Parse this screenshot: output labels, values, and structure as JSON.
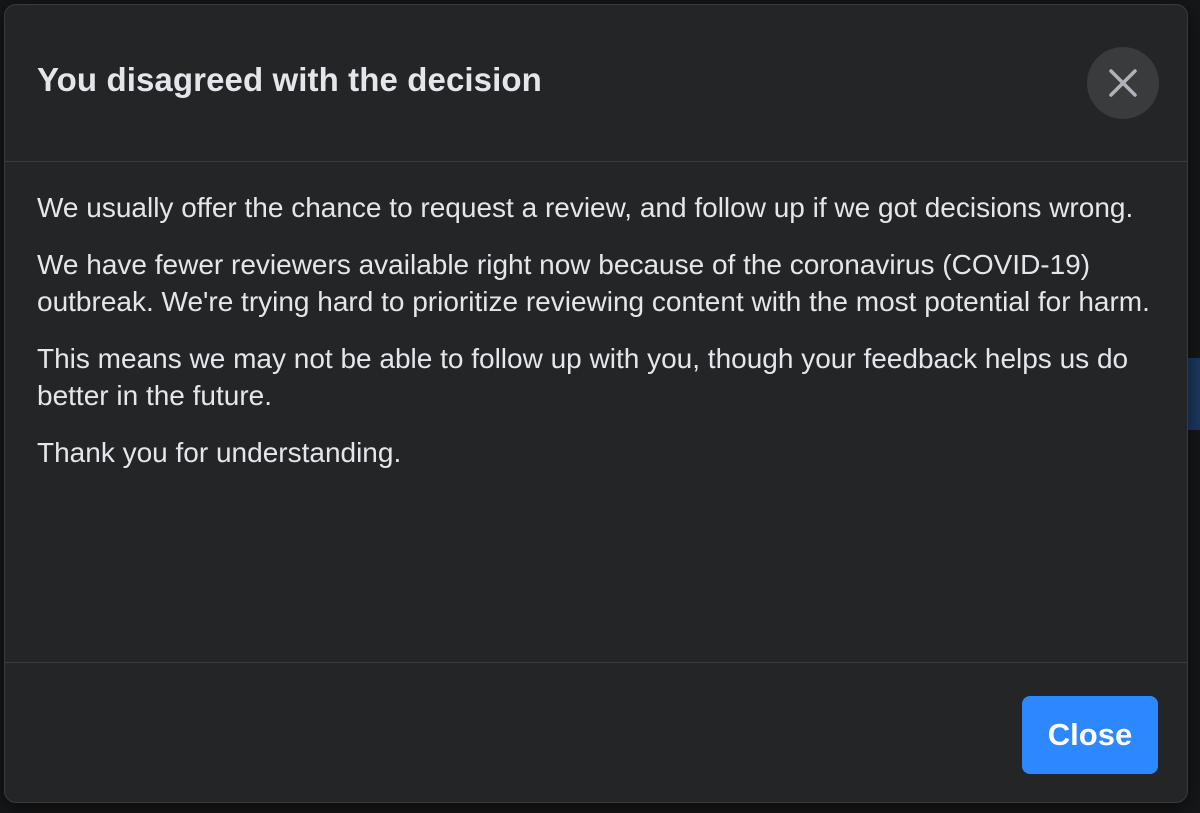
{
  "dialog": {
    "title": "You disagreed with the decision",
    "close_icon": "close-icon",
    "paragraphs": [
      "We usually offer the chance to request a review, and follow up if we got decisions wrong.",
      "We have fewer reviewers available right now because of the coronavirus (COVID-19) outbreak. We're trying hard to prioritize reviewing content with the most potential for harm.",
      "This means we may not be able to follow up with you, though your feedback helps us do better in the future.",
      "Thank you for understanding."
    ],
    "close_button_label": "Close"
  },
  "colors": {
    "dialog_background": "#242526",
    "text": "#e4e6eb",
    "accent": "#2d88ff",
    "divider": "#3a3b3c"
  }
}
